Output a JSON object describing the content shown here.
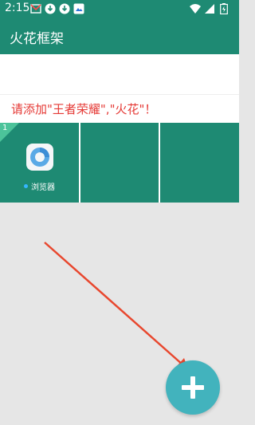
{
  "status_bar": {
    "time": "2:15",
    "notification_icons": [
      "mail-icon",
      "download-icon",
      "download-icon",
      "image-icon"
    ],
    "right_icons": [
      "wifi-icon",
      "signal-icon",
      "battery-icon"
    ]
  },
  "app_bar": {
    "title": "火花框架"
  },
  "note": {
    "text": "请添加\"王者荣耀\",\"火花\"！",
    "color": "#e53935"
  },
  "grid": {
    "slots": [
      {
        "badge": "1",
        "app_label": "浏览器",
        "icon": "browser-icon"
      },
      {
        "badge": "",
        "app_label": "",
        "icon": ""
      },
      {
        "badge": "",
        "app_label": "",
        "icon": ""
      }
    ]
  },
  "fab": {
    "icon": "plus-icon",
    "color": "#42b3bd"
  },
  "colors": {
    "primary": "#1e8a73",
    "accent": "#4cc39a",
    "arrow": "#e8472e"
  }
}
